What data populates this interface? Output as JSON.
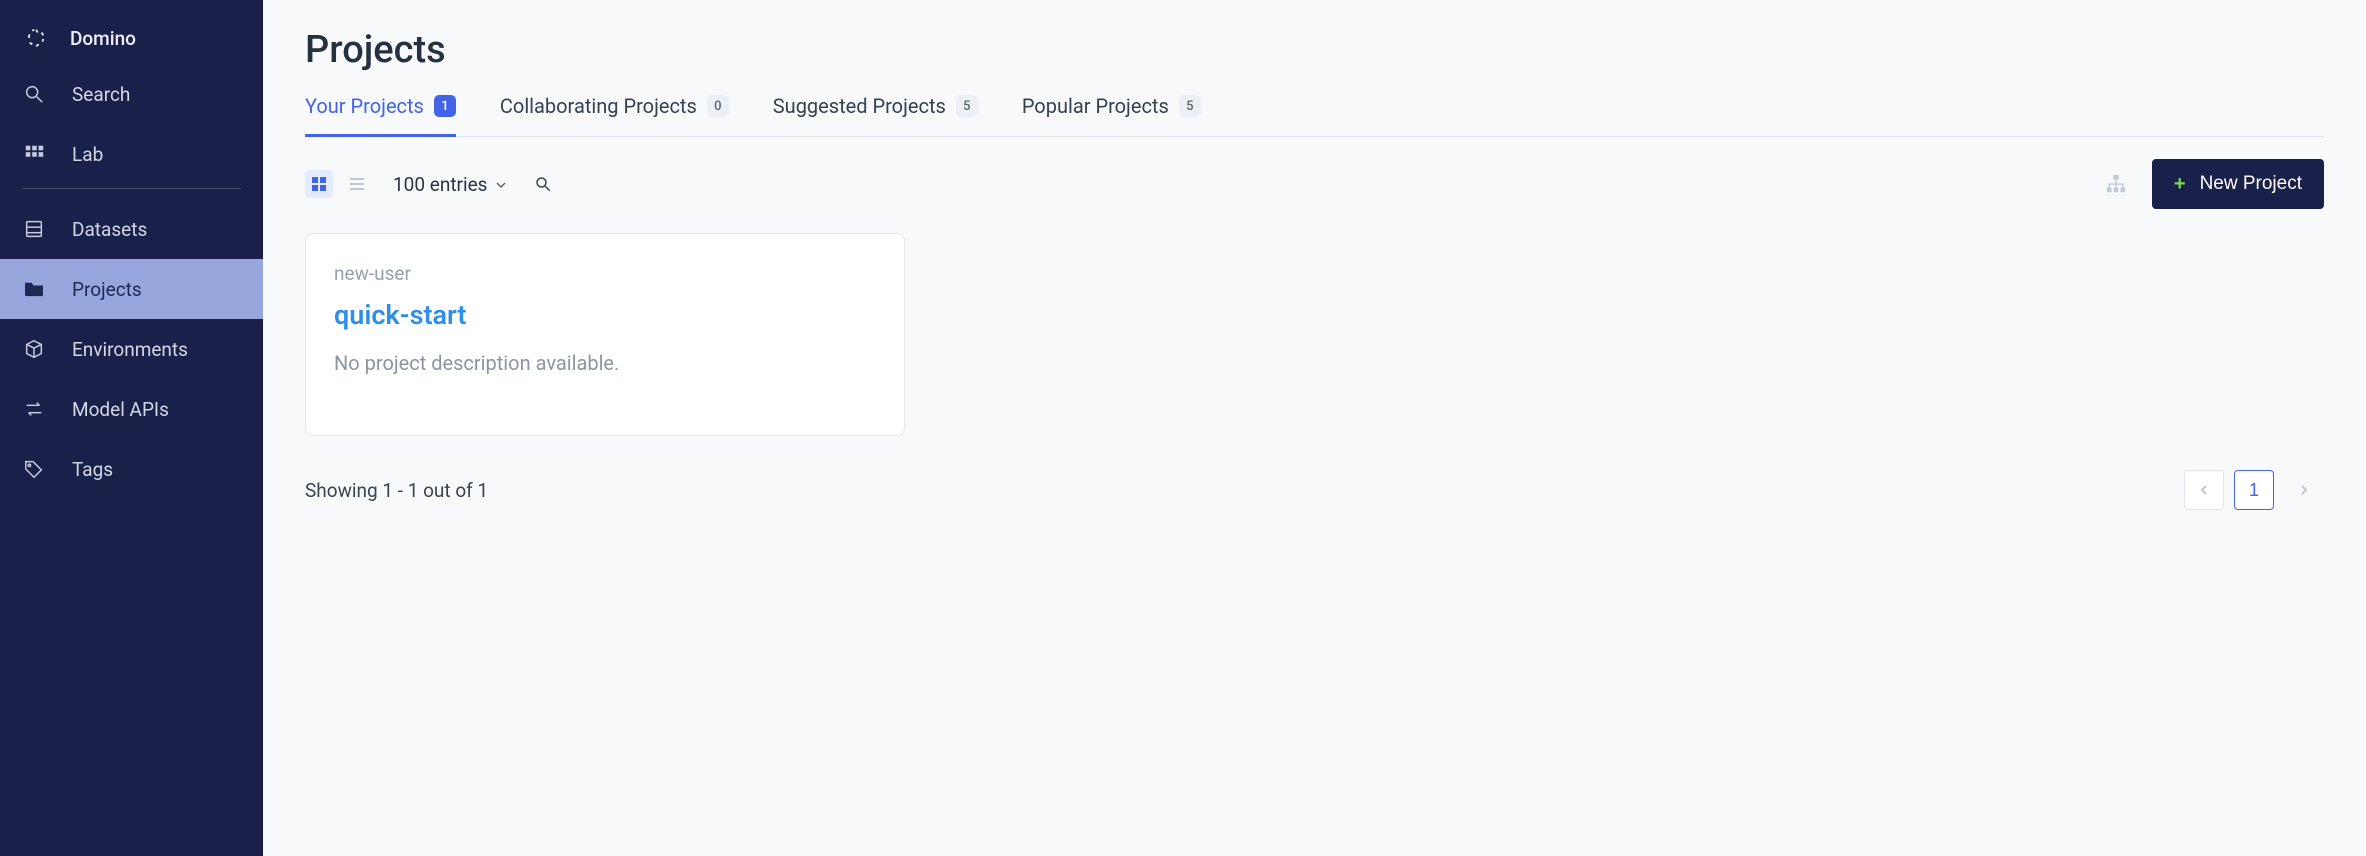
{
  "brand": {
    "name": "Domino"
  },
  "sidebar": {
    "items": [
      {
        "label": "Search"
      },
      {
        "label": "Lab"
      },
      {
        "label": "Datasets"
      },
      {
        "label": "Projects"
      },
      {
        "label": "Environments"
      },
      {
        "label": "Model APIs"
      },
      {
        "label": "Tags"
      }
    ]
  },
  "page": {
    "title": "Projects"
  },
  "tabs": [
    {
      "label": "Your Projects",
      "count": "1"
    },
    {
      "label": "Collaborating Projects",
      "count": "0"
    },
    {
      "label": "Suggested Projects",
      "count": "5"
    },
    {
      "label": "Popular Projects",
      "count": "5"
    }
  ],
  "toolbar": {
    "entries_label": "100 entries",
    "new_project_label": "New Project"
  },
  "project_card": {
    "owner": "new-user",
    "title": "quick-start",
    "description": "No project description available."
  },
  "footer": {
    "showing": "Showing 1 - 1 out of 1",
    "pages": [
      {
        "label": "1"
      }
    ]
  }
}
